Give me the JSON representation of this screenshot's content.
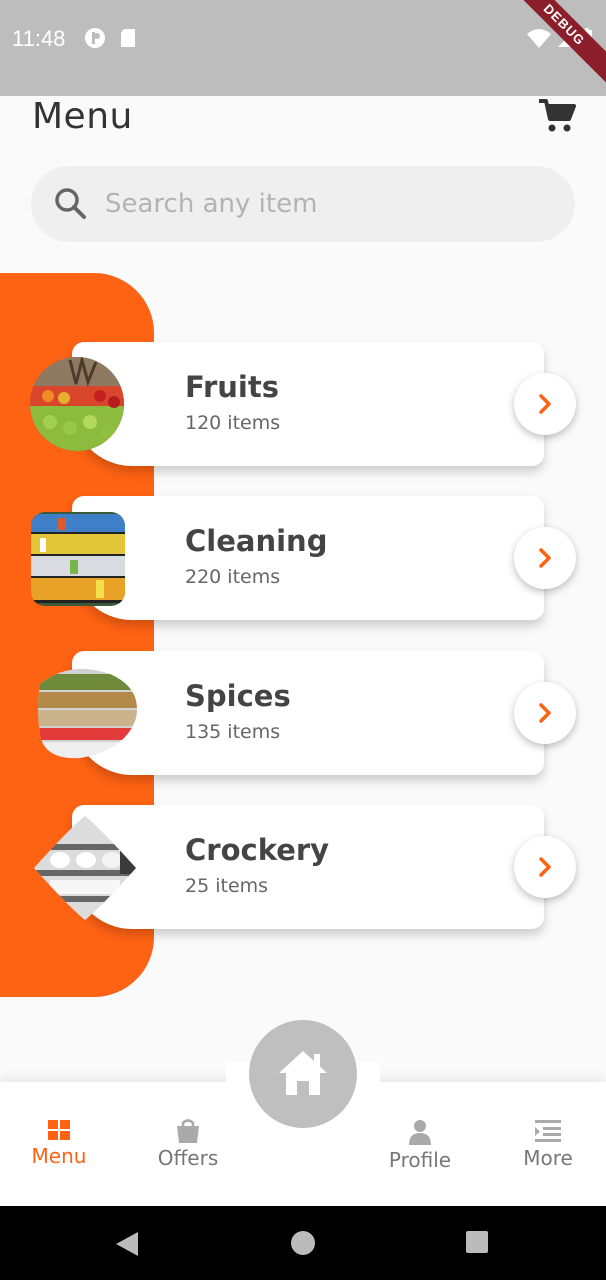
{
  "status_bar": {
    "time": "11:48",
    "debug_label": "DEBUG"
  },
  "header": {
    "title": "Menu"
  },
  "search": {
    "placeholder": "Search any item"
  },
  "categories": [
    {
      "name": "Fruits",
      "count": "120 items"
    },
    {
      "name": "Cleaning",
      "count": "220 items"
    },
    {
      "name": "Spices",
      "count": "135 items"
    },
    {
      "name": "Crockery",
      "count": "25 items"
    }
  ],
  "bottom_nav": {
    "items": [
      {
        "label": "Menu",
        "icon": "grid-icon",
        "active": true
      },
      {
        "label": "Offers",
        "icon": "bag-icon",
        "active": false
      },
      {
        "label": "Profile",
        "icon": "person-icon",
        "active": false
      },
      {
        "label": "More",
        "icon": "list-icon",
        "active": false
      }
    ],
    "center_icon": "home-icon"
  },
  "colors": {
    "accent": "#fe6213",
    "status_bar": "#bdbdbd",
    "card_text": "#444444"
  }
}
